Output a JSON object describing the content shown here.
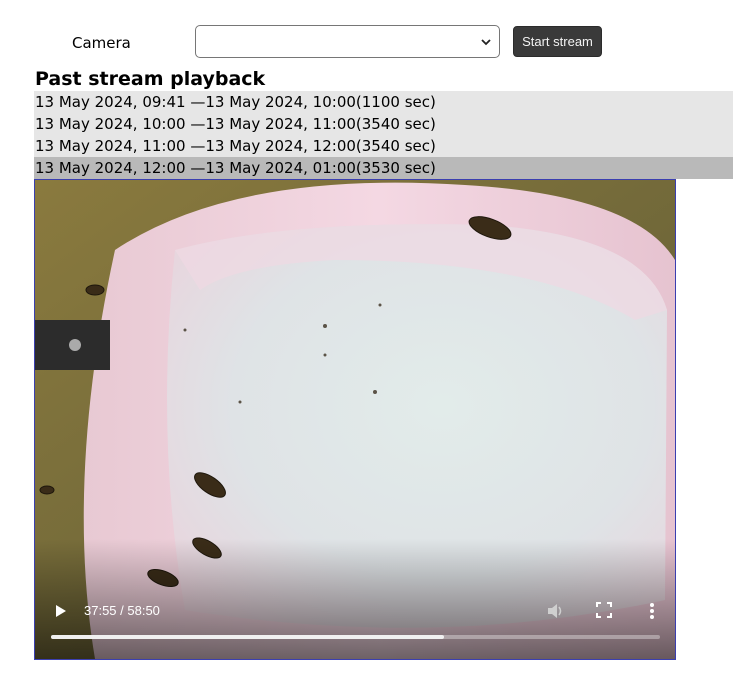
{
  "camera": {
    "label": "Camera",
    "selected_value": "",
    "start_button_label": "Start stream"
  },
  "playback": {
    "heading": "Past stream playback",
    "items": [
      {
        "label": "13 May 2024, 09:41 —13 May 2024, 10:00(1100 sec)",
        "selected": false
      },
      {
        "label": "13 May 2024, 10:00 —13 May 2024, 11:00(3540 sec)",
        "selected": false
      },
      {
        "label": "13 May 2024, 11:00 —13 May 2024, 12:00(3540 sec)",
        "selected": false
      },
      {
        "label": "13 May 2024, 12:00 —13 May 2024, 01:00(3530 sec)",
        "selected": true
      }
    ]
  },
  "video": {
    "time_display": "37:55 / 58:50",
    "progress_fraction": 0.645,
    "controls": [
      "play-icon",
      "volume-icon",
      "fullscreen-icon",
      "more-options-icon"
    ]
  },
  "colors": {
    "list_item_bg": "#e6e6e6",
    "list_item_selected_bg": "#b9b9b9",
    "button_bg": "#3a3a3a",
    "video_border": "#3b3fb0"
  }
}
